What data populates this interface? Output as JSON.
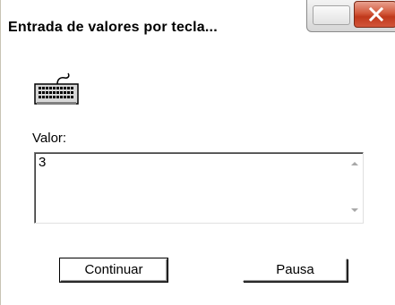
{
  "window": {
    "title": "Entrada de valores por tecla..."
  },
  "icons": {
    "close": "close-icon",
    "keyboard": "keyboard-icon",
    "scroll_up": "scroll-up-arrow-icon",
    "scroll_down": "scroll-down-arrow-icon"
  },
  "form": {
    "label": "Valor:",
    "value": "3"
  },
  "buttons": {
    "continue_label": "Continuar",
    "pause_label": "Pausa"
  },
  "colors": {
    "close_button": "#c8442a",
    "background": "#ffffff"
  }
}
